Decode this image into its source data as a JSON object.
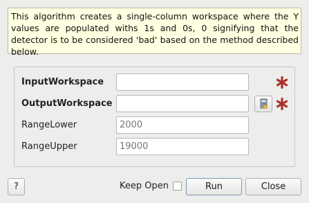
{
  "description": "This algorithm creates a single-column workspace where the Y values are populated withs 1s and 0s, 0 signifying that the detector is to be considered 'bad' based on the method described below.",
  "properties": [
    {
      "label": "InputWorkspace",
      "value": "",
      "placeholder": "",
      "required": true
    },
    {
      "label": "OutputWorkspace",
      "value": "",
      "placeholder": "",
      "required": true
    },
    {
      "label": "RangeLower",
      "value": "",
      "placeholder": "2000",
      "required": false
    },
    {
      "label": "RangeUpper",
      "value": "",
      "placeholder": "19000",
      "required": false
    }
  ],
  "icons": {
    "required": "red-asterisk-icon",
    "browse": "workspace-browse-icon"
  },
  "colors": {
    "description_bg": "#ffffe1",
    "required_star": "#a8332b",
    "window_bg": "#ededec"
  },
  "footer": {
    "help_label": "?",
    "keep_open_label": "Keep Open",
    "keep_open_checked": false,
    "run_label": "Run",
    "close_label": "Close"
  }
}
